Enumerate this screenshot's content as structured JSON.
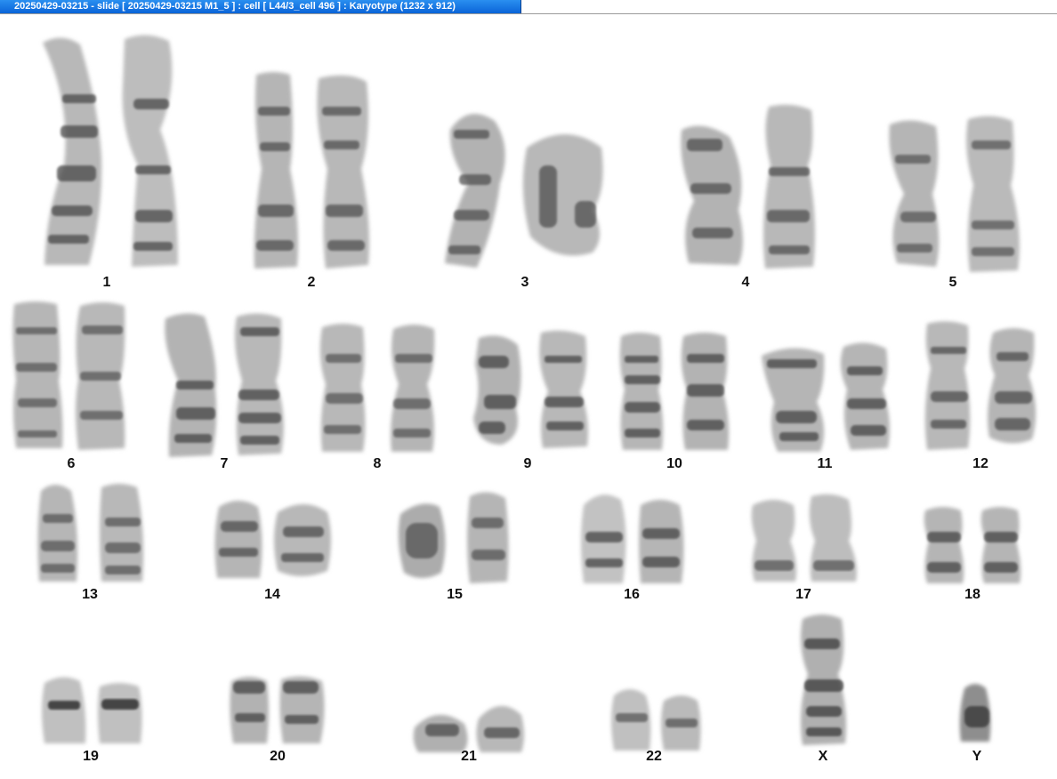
{
  "window": {
    "title": "20250429-03215 - slide [ 20250429-03215 M1_5 ] : cell [ L44/3_cell 496 ] : Karyotype  (1232 x 912)"
  },
  "karyotype": {
    "labels": [
      "1",
      "2",
      "3",
      "4",
      "5",
      "6",
      "7",
      "8",
      "9",
      "10",
      "11",
      "12",
      "13",
      "14",
      "15",
      "16",
      "17",
      "18",
      "19",
      "20",
      "21",
      "22",
      "X",
      "Y"
    ]
  },
  "colors": {
    "title_bar": "#0a64d8",
    "chromosome": "#3a3a3a",
    "background": "#ffffff"
  }
}
